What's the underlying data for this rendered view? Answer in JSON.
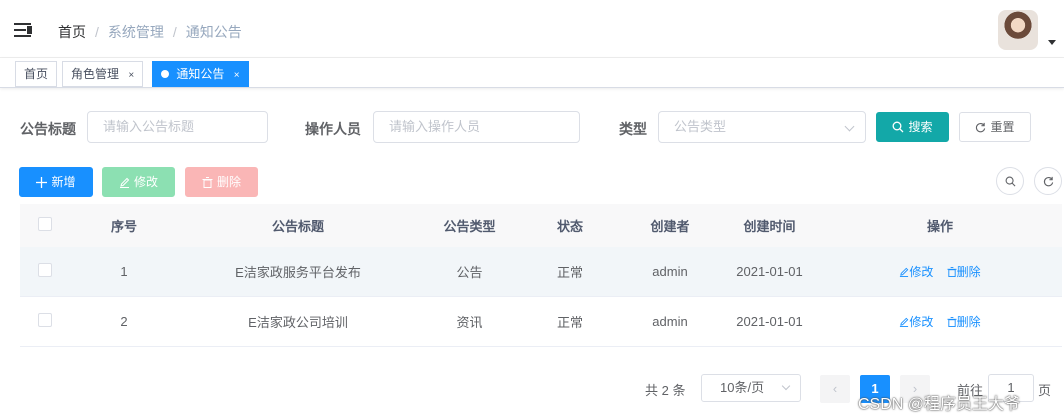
{
  "navbar": {
    "breadcrumb": [
      "首页",
      "系统管理",
      "通知公告"
    ],
    "separator": "/"
  },
  "tags": {
    "items": [
      {
        "label": "首页",
        "closable": false,
        "active": false
      },
      {
        "label": "角色管理",
        "closable": true,
        "active": false
      },
      {
        "label": "通知公告",
        "closable": true,
        "active": true
      }
    ],
    "close_glyph": "×"
  },
  "search": {
    "title_label": "公告标题",
    "title_placeholder": "请输入公告标题",
    "operator_label": "操作人员",
    "operator_placeholder": "请输入操作人员",
    "type_label": "类型",
    "type_placeholder": "公告类型",
    "search_button": "搜索",
    "reset_button": "重置"
  },
  "toolbar": {
    "add": "新增",
    "edit": "修改",
    "delete": "删除"
  },
  "table": {
    "columns": [
      "序号",
      "公告标题",
      "公告类型",
      "状态",
      "创建者",
      "创建时间",
      "操作"
    ],
    "rows": [
      {
        "index": "1",
        "title": "E洁家政服务平台发布",
        "type": "公告",
        "status": "正常",
        "creator": "admin",
        "created": "2021-01-01"
      },
      {
        "index": "2",
        "title": "E洁家政公司培训",
        "type": "资讯",
        "status": "正常",
        "creator": "admin",
        "created": "2021-01-01"
      }
    ],
    "action_edit": "修改",
    "action_delete": "删除"
  },
  "pagination": {
    "total": "共 2 条",
    "page_size": "10条/页",
    "current_page": "1",
    "goto_prefix": "前往",
    "goto_value": "1",
    "goto_suffix": "页"
  },
  "watermark": "CSDN @程序员王大爷",
  "colors": {
    "primary": "#1890ff",
    "search": "#13a8a8",
    "success_light": "#8ce0b2",
    "danger_light": "#fab6b6"
  }
}
